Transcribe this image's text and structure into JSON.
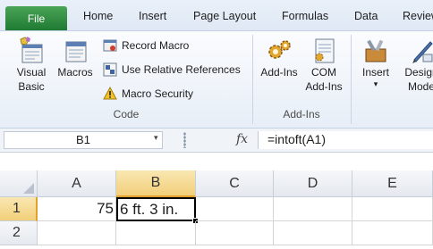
{
  "tabs": {
    "file": "File",
    "home": "Home",
    "insert": "Insert",
    "page_layout": "Page Layout",
    "formulas": "Formulas",
    "data": "Data",
    "review": "Review"
  },
  "ribbon": {
    "code_group": {
      "label": "Code",
      "visual_basic": [
        "Visual",
        "Basic"
      ],
      "macros": "Macros",
      "record_macro": "Record Macro",
      "use_relative_references": "Use Relative References",
      "macro_security": "Macro Security"
    },
    "addins_group": {
      "label": "Add-Ins",
      "add_ins": "Add-Ins",
      "com_add_ins": [
        "COM",
        "Add-Ins"
      ]
    },
    "controls_group": {
      "insert": "Insert",
      "design_mode": [
        "Design",
        "Mode"
      ]
    }
  },
  "formula_bar": {
    "name_box": "B1",
    "fx": "fx",
    "formula": "=intoft(A1)"
  },
  "grid": {
    "columns": [
      "A",
      "B",
      "C",
      "D",
      "E"
    ],
    "rows": [
      "1",
      "2"
    ],
    "cells": {
      "A1": "75",
      "B1": "6 ft. 3 in."
    },
    "selected_cell": "B1"
  },
  "colors": {
    "file_tab": "#2a8a3e",
    "selection_border": "#000000"
  }
}
